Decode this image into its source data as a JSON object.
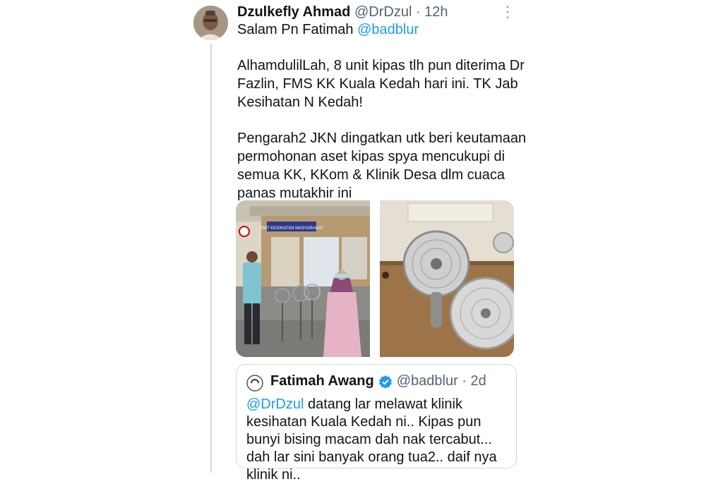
{
  "tweet": {
    "author_name": "Dzulkefly Ahmad",
    "handle_time": "@DrDzul · 12h",
    "reply_prefix": "Salam Pn Fatimah",
    "reply_mention": "@badblur",
    "paragraph1": "AlhamdulilLah, 8 unit kipas tlh pun diterima Dr Fazlin, FMS KK Kuala Kedah hari ini. TK Jab Kesihatan N Kedah!",
    "paragraph2": "Pengarah2 JKN dingatkan utk beri keutamaan permohonan aset kipas spya mencukupi di semua KK, KKom & Klinik Desa dlm cuaca panas mutakhir ini",
    "more_icon": "⋮"
  },
  "quote": {
    "author_name": "Fatimah Awang",
    "handle_time": "@badblur · 2d",
    "mention": "@DrDzul",
    "text": " datang lar melawat klinik kesihatan Kuala Kedah ni.. Kipas pun bunyi bising macam dah nak tercabut... dah lar sini banyak orang tua2.. daif nya klinik ni..",
    "verified_color": "#1d9bf0"
  },
  "images": {
    "left_sign_text": "UNIT KESIHATAN MASYARAKAT"
  },
  "colors": {
    "link": "#1d9bf0",
    "muted": "#536471",
    "border": "#cfd9de"
  }
}
